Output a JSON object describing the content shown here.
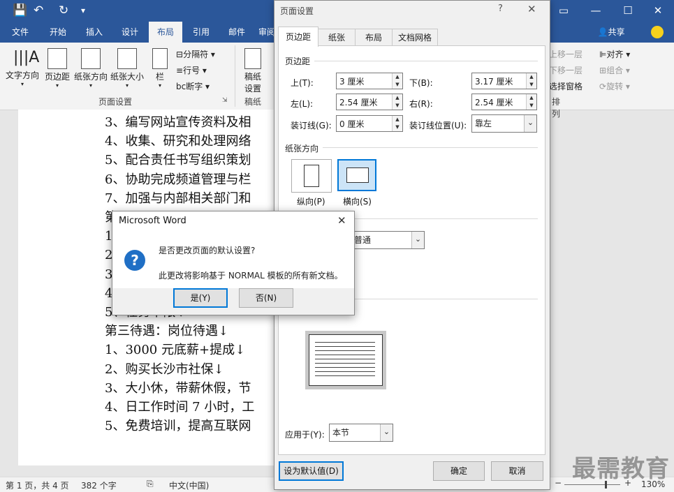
{
  "app": {
    "qat": [
      "💾",
      "↶",
      "↻",
      "▾"
    ],
    "ribbon_tabs": [
      "文件",
      "开始",
      "插入",
      "设计",
      "布局",
      "引用",
      "邮件",
      "审阅"
    ],
    "active_tab": "布局",
    "share": "共享",
    "right_gray": [
      "上移一层",
      "下移一层",
      "选择窗格"
    ],
    "align_items": [
      "对齐",
      "组合",
      "旋转"
    ],
    "arrange_label": "排列"
  },
  "ribbon": {
    "text_direction": "文字方向",
    "margins": "页边距",
    "orientation": "纸张方向",
    "size": "纸张大小",
    "columns": "栏",
    "breaks": "分隔符",
    "line_numbers": "行号",
    "hyphenation": "断字",
    "page_setup_group": "页面设置",
    "manuscript_setup_l1": "稿纸",
    "manuscript_setup_l2": "设置",
    "manuscript_group": "稿纸"
  },
  "document": {
    "lines": [
      "3、编写网站宣传资料及相",
      "4、收集、研究和处理网络",
      "5、配合责任书写组织策划",
      "6、协助完成频道管理与栏",
      "7、加强与内部相关部门和",
      "第",
      "1",
      "2",
      "3",
      "4",
      "5、任务下限↓",
      "第三待遇：岗位待遇↓",
      "1、3000 元底薪+提成↓",
      "2、购买长沙市社保↓",
      "3、大小休，带薪休假，节",
      "4、日工作时间 7 小时，工",
      "5、免费培训，提高互联网"
    ]
  },
  "status": {
    "page": "第 1 页，共 4 页",
    "words": "382 个字",
    "lang": "中文(中国)",
    "zoom": "130%",
    "zoom_level": 0.72
  },
  "page_setup": {
    "title": "页面设置",
    "help": "?",
    "close": "✕",
    "tabs": [
      "页边距",
      "纸张",
      "布局",
      "文档网格"
    ],
    "active_tab": 0,
    "margins_section": "页边距",
    "top_label": "上(T):",
    "top_value": "3 厘米",
    "bottom_label": "下(B):",
    "bottom_value": "3.17 厘米",
    "left_label": "左(L):",
    "left_value": "2.54 厘米",
    "right_label": "右(R):",
    "right_value": "2.54 厘米",
    "gutter_label": "装订线(G):",
    "gutter_value": "0 厘米",
    "gutter_pos_label": "装订线位置(U):",
    "gutter_pos_value": "靠左",
    "orientation_section": "纸张方向",
    "portrait": "纵向(P)",
    "landscape": "横向(S)",
    "multi_pages_value": "普通",
    "apply_label": "应用于(Y):",
    "apply_value": "本节",
    "set_default": "设为默认值(D)",
    "ok": "确定",
    "cancel": "取消"
  },
  "message_box": {
    "title": "Microsoft Word",
    "close": "✕",
    "icon": "?",
    "question": "是否更改页面的默认设置?",
    "detail": "此更改将影响基于 NORMAL 模板的所有新文档。",
    "yes": "是(Y)",
    "no": "否(N)"
  },
  "watermark": "最需教育"
}
